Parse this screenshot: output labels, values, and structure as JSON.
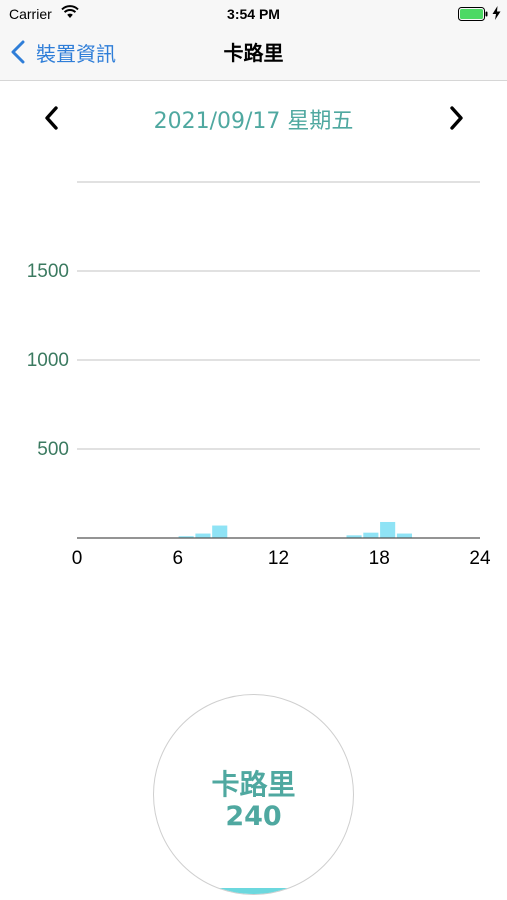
{
  "status_bar": {
    "carrier": "Carrier",
    "time": "3:54 PM",
    "battery_level": 1.0,
    "charging": true
  },
  "nav": {
    "back_label": "裝置資訊",
    "title": "卡路里"
  },
  "date_nav": {
    "date": "2021/09/17 星期五",
    "prev_icon": "chevron-left-icon",
    "next_icon": "chevron-right-icon"
  },
  "chart_data": {
    "type": "bar",
    "x": [
      6,
      7,
      8,
      16,
      17,
      18,
      19
    ],
    "values": [
      10,
      25,
      70,
      15,
      30,
      90,
      25
    ],
    "xlim": [
      0,
      24
    ],
    "ylim": [
      0,
      2000
    ],
    "x_ticks": [
      0,
      6,
      12,
      18,
      24
    ],
    "y_ticks": [
      500,
      1000,
      1500
    ],
    "grid": true,
    "bar_color": "#8fe3f5",
    "tick_color_y": "#3b7a60"
  },
  "summary": {
    "label": "卡路里",
    "value": "240",
    "fill_fraction": 0.03,
    "accent_color": "#4fa8a0"
  }
}
